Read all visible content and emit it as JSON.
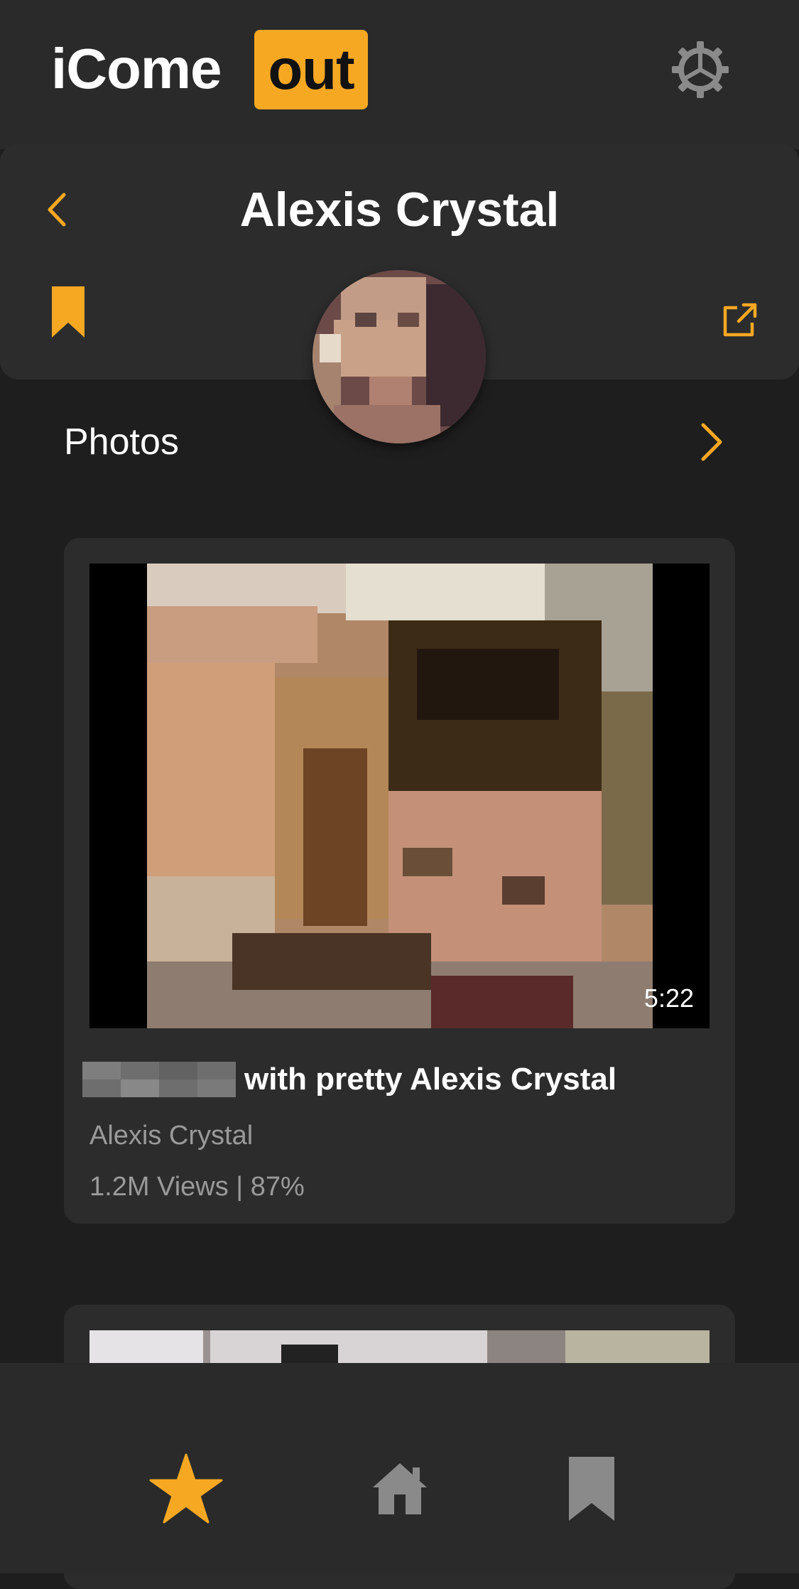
{
  "header": {
    "logo_text": "iCome",
    "logo_badge": "out",
    "settings_icon": "gear-icon"
  },
  "profile": {
    "name": "Alexis Crystal",
    "back_icon": "chevron-left-icon",
    "bookmark_icon": "bookmark-icon",
    "share_icon": "external-link-icon"
  },
  "section": {
    "title": "Photos",
    "more_icon": "chevron-right-icon"
  },
  "videos": [
    {
      "duration": "5:22",
      "title": "with pretty Alexis Crystal",
      "performer": "Alexis Crystal",
      "stats": "1.2M Views | 87%"
    }
  ],
  "bottom_nav": [
    {
      "icon": "star-icon",
      "active": true
    },
    {
      "icon": "home-icon",
      "active": false
    },
    {
      "icon": "bookmark-icon",
      "active": false
    }
  ],
  "colors": {
    "accent": "#f7a823",
    "background": "#1e1e1e",
    "surface": "#2c2c2c",
    "muted_text": "#9a9a9a",
    "inactive_icon": "#8a8a8a"
  }
}
